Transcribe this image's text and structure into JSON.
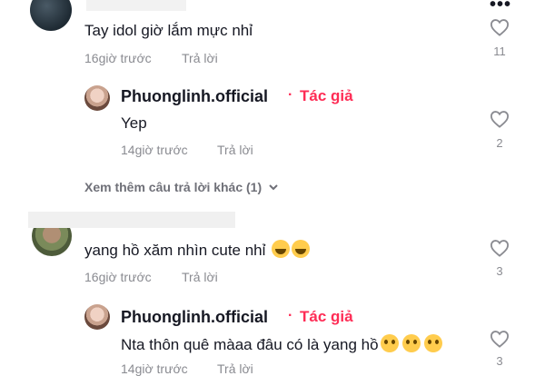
{
  "comments": [
    {
      "text": "Tay idol giờ lắm mực nhỉ",
      "time": "16giờ trước",
      "reply_label": "Trả lời",
      "likes": "11",
      "replies": [
        {
          "username": "Phuonglinh.official",
          "separator": "·",
          "author_badge": "Tác giả",
          "text": "Yep",
          "time": "14giờ trước",
          "reply_label": "Trả lời",
          "likes": "2"
        }
      ],
      "view_more": "Xem thêm câu trả lời khác (1)"
    },
    {
      "text": "yang hồ xăm nhìn cute nhỉ",
      "time": "16giờ trước",
      "reply_label": "Trả lời",
      "likes": "3",
      "replies": [
        {
          "username": "Phuonglinh.official",
          "separator": "·",
          "author_badge": "Tác giả",
          "text": "Nta thôn quê màaa đâu có là yang hồ",
          "time": "14giờ trước",
          "reply_label": "Trả lời",
          "likes": "3"
        }
      ]
    }
  ],
  "more_options": "•••",
  "icons": {
    "like": "heart-outline-icon",
    "expand": "chevron-down-icon",
    "more": "more-options-icon"
  },
  "colors": {
    "author_badge": "#fe2c55",
    "secondary_text": "#8a8b91",
    "primary_text": "#161823"
  }
}
